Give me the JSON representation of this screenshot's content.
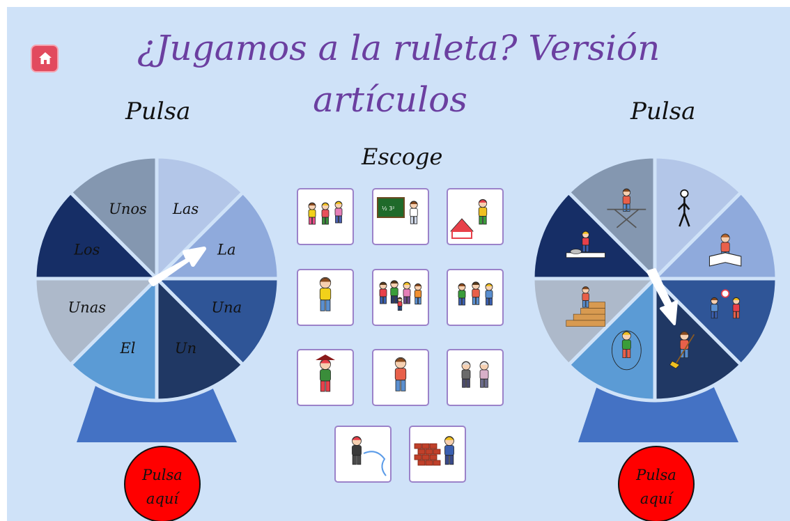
{
  "title": {
    "line1": "¿Jugamos a la ruleta? Versión",
    "line2": "artículos"
  },
  "left_prompt": "Pulsa",
  "right_prompt": "Pulsa",
  "center_prompt": "Escoge",
  "spin_button_left": {
    "line1": "Pulsa",
    "line2": "aquí"
  },
  "spin_button_right": {
    "line1": "Pulsa",
    "line2": "aquí"
  },
  "left_wheel": {
    "segments": [
      "Las",
      "La",
      "Una",
      "Un",
      "El",
      "Unas",
      "Los",
      "Unos"
    ]
  },
  "right_wheel": {
    "segments": [
      "walking-person-icon",
      "reading-child-icon",
      "children-playing-ball-icon",
      "child-sweeping-icon",
      "girl-jumping-rope-icon",
      "child-climbing-stairs-icon",
      "person-eating-icon",
      "person-ironing-icon"
    ]
  },
  "choices": [
    "three-girls-icon",
    "teacher-blackboard-icon",
    "clown-circus-icon",
    "girl-icon",
    "family-group-icon",
    "three-boys-icon",
    "pirate-girl-icon",
    "boy-icon",
    "grandparents-icon",
    "firefighter-icon",
    "bricklayer-icon"
  ],
  "colors": {
    "background": "#cfe2f8",
    "title": "#6b3fa0",
    "spin_button": "#ff0000",
    "home_button": "#e24a5e",
    "stand": "#4472c4",
    "tile_border": "#9b82c9",
    "segment_colors": [
      "#b3c6e8",
      "#8faadc",
      "#2f5597",
      "#203864",
      "#5b9bd5",
      "#adb9ca",
      "#162e66",
      "#8497b0"
    ]
  }
}
